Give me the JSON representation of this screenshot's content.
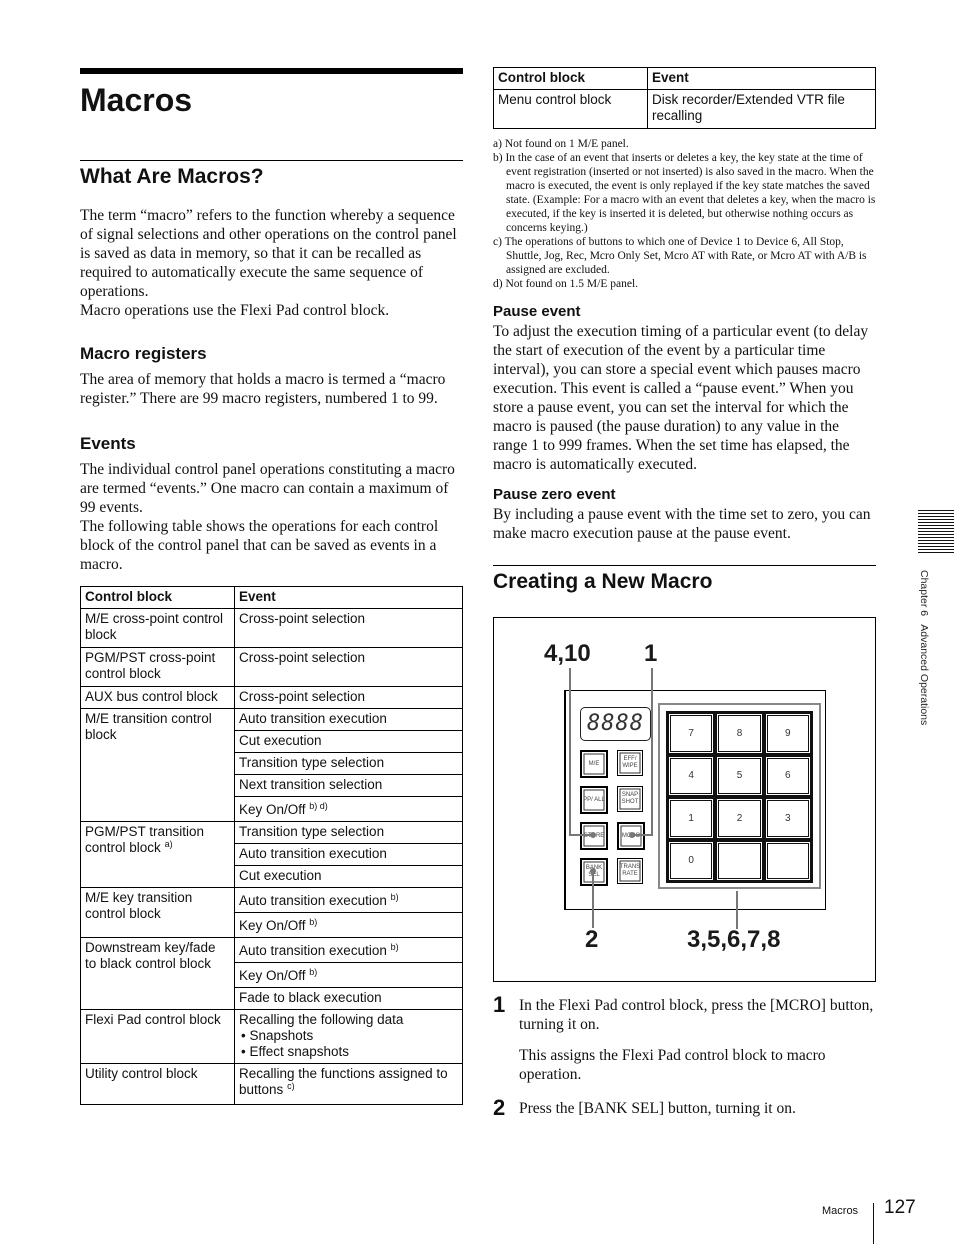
{
  "page": {
    "title": "Macros",
    "number": "127",
    "footer_label": "Macros",
    "side_tab": "Chapter 6   Advanced Operations"
  },
  "what_are_macros": {
    "heading": "What Are Macros?",
    "para1": "The term “macro” refers to the function whereby a sequence of signal selections and other operations on the control panel is saved as data in memory, so that it can be recalled as required to automatically execute the same sequence of operations.",
    "para2": "Macro operations use the Flexi Pad control block."
  },
  "macro_registers": {
    "heading": "Macro registers",
    "para": "The area of memory that holds a macro is termed a “macro register.” There are 99 macro registers, numbered 1 to 99."
  },
  "events": {
    "heading": "Events",
    "para1": "The individual control panel operations constituting a macro are termed “events.” One macro can contain a maximum of 99 events.",
    "para2": "The following table shows the operations for each control block of the control panel that can be saved as events in a macro."
  },
  "events_table": {
    "headers": [
      "Control block",
      "Event"
    ],
    "rows": [
      {
        "block": "M/E cross-point control block",
        "events": [
          {
            "text": "Cross-point selection",
            "note": ""
          }
        ]
      },
      {
        "block": "PGM/PST cross-point control block",
        "events": [
          {
            "text": "Cross-point selection",
            "note": ""
          }
        ]
      },
      {
        "block": "AUX bus control block",
        "events": [
          {
            "text": "Cross-point selection",
            "note": ""
          }
        ]
      },
      {
        "block": "M/E transition control block",
        "events": [
          {
            "text": "Auto transition execution",
            "note": ""
          },
          {
            "text": "Cut execution",
            "note": ""
          },
          {
            "text": "Transition type selection",
            "note": ""
          },
          {
            "text": "Next transition selection",
            "note": ""
          },
          {
            "text": "Key On/Off",
            "note": "b) d)"
          }
        ]
      },
      {
        "block": "PGM/PST transition control block",
        "block_note": "a)",
        "events": [
          {
            "text": "Transition type selection",
            "note": ""
          },
          {
            "text": "Auto transition execution",
            "note": ""
          },
          {
            "text": "Cut execution",
            "note": ""
          }
        ]
      },
      {
        "block": "M/E key transition control block",
        "events": [
          {
            "text": "Auto transition execution",
            "note": "b)"
          },
          {
            "text": "Key On/Off",
            "note": "b)"
          }
        ]
      },
      {
        "block": "Downstream key/fade to black control block",
        "events": [
          {
            "text": "Auto transition execution",
            "note": "b)"
          },
          {
            "text": "Key On/Off",
            "note": "b)"
          },
          {
            "text": "Fade to black execution",
            "note": ""
          }
        ]
      },
      {
        "block": "Flexi Pad control block",
        "events": [
          {
            "text": "Recalling the following data",
            "note": "",
            "bullets": [
              "Snapshots",
              "Effect snapshots"
            ]
          }
        ]
      },
      {
        "block": "Utility control block",
        "events": [
          {
            "text": "Recalling the functions assigned to buttons",
            "note": "c)"
          }
        ]
      }
    ]
  },
  "continued_table": {
    "headers": [
      "Control block",
      "Event"
    ],
    "rows": [
      {
        "block": "Menu control block",
        "event": "Disk recorder/Extended VTR file recalling"
      }
    ]
  },
  "notes": [
    {
      "label": "a)",
      "text": "Not found on 1 M/E panel."
    },
    {
      "label": "b)",
      "text": "In the case of an event that inserts or deletes a key, the key state at the time of event registration (inserted or not inserted) is also saved in the macro. When the macro is executed, the event is only replayed if the key state matches the saved state. (Example: For a macro with an event that deletes a key, when the macro is executed, if the key is inserted it is deleted, but otherwise nothing occurs as concerns keying.)"
    },
    {
      "label": "c)",
      "text": "The operations of buttons to which one of Device 1 to Device 6, All Stop, Shuttle, Jog, Rec, Mcro Only Set, Mcro AT with Rate, or Mcro AT with A/B is assigned are excluded."
    },
    {
      "label": "d)",
      "text": "Not found on 1.5 M/E panel."
    }
  ],
  "pause_event": {
    "heading": "Pause event",
    "para": "To adjust the execution timing of a particular event (to delay the start of execution of the event by a particular time interval), you can store a special event which pauses macro execution. This event is called a “pause event.” When you store a pause event, you can set the interval for which the macro is paused (the pause duration) to any value in the range 1 to 999 frames. When the set time has elapsed, the macro is automatically executed."
  },
  "pause_zero_event": {
    "heading": "Pause zero event",
    "para": "By including a pause event with the time set to zero, you can make macro execution pause at the pause event."
  },
  "creating": {
    "heading": "Creating a New Macro"
  },
  "figure": {
    "callouts": {
      "store": "4,10",
      "mcro": "1",
      "bank_sel": "2",
      "keypad": "3,5,6,7,8"
    },
    "display": "8888",
    "buttons": {
      "me": "M/E",
      "eff_wipe": "EFF/ WIPE",
      "pp_all": "PP/ ALL",
      "snapshot": "SNAP SHOT",
      "store": "STORE",
      "mcro": "MCRO",
      "bank_sel": "BANK SEL",
      "trans_rate": "TRANS RATE"
    },
    "keys": [
      "7",
      "8",
      "9",
      "4",
      "5",
      "6",
      "1",
      "2",
      "3",
      "0",
      "",
      ""
    ]
  },
  "steps": [
    {
      "num": "1",
      "text": "In the Flexi Pad control block, press the [MCRO] button, turning it on.",
      "detail": "This assigns the Flexi Pad control block to macro operation."
    },
    {
      "num": "2",
      "text": "Press the [BANK SEL] button, turning it on.",
      "detail": ""
    }
  ]
}
